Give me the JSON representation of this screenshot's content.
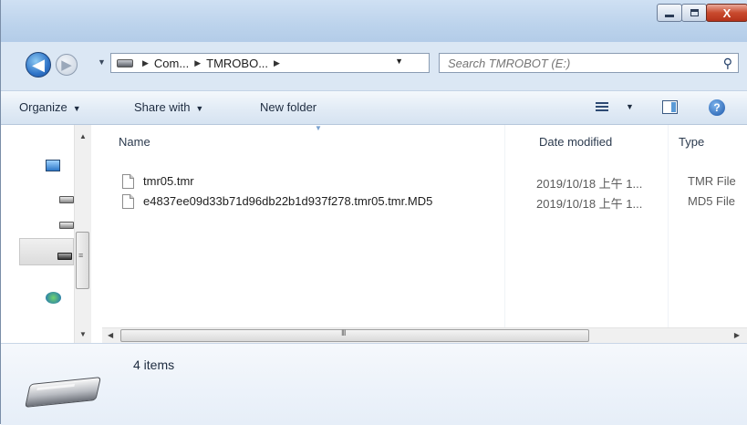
{
  "window": {
    "caption": {
      "minimize": "",
      "maximize": "",
      "close": "X"
    }
  },
  "address_bar": {
    "crumbs": [
      "Com...",
      "TMROBO..."
    ],
    "search_placeholder": "Search TMROBOT (E:)"
  },
  "command_bar": {
    "organize": "Organize",
    "share_with": "Share with",
    "new_folder": "New folder",
    "carets": "▼"
  },
  "columns": {
    "name": "Name",
    "date_modified": "Date modified",
    "type": "Type"
  },
  "files": [
    {
      "name": "tmr05.tmr",
      "date": "2019/10/18 上午 1...",
      "type": "TMR File"
    },
    {
      "name": "e4837ee09d33b71d96db22b1d937f278.tmr05.tmr.MD5",
      "date": "2019/10/18 上午 1...",
      "type": "MD5 File"
    }
  ],
  "status": {
    "item_count": "4 items"
  },
  "scroll_glyphs": {
    "grip_v": "≡",
    "grip_h": "III"
  }
}
